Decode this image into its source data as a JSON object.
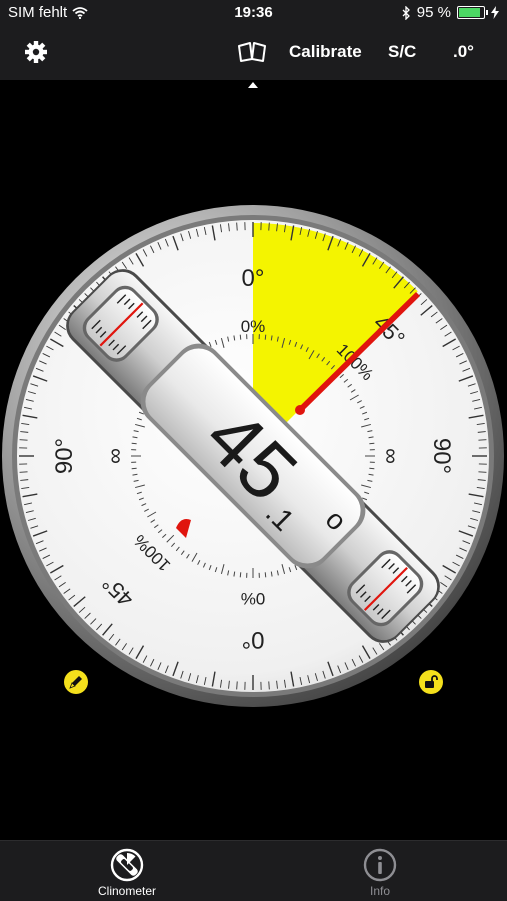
{
  "status_bar": {
    "carrier": "SIM fehlt",
    "wifi_icon": "wifi-icon",
    "time": "19:36",
    "bluetooth_icon": "bluetooth-icon",
    "battery_percent": "95 %",
    "battery_level": 0.95,
    "charging_icon": "bolt-icon"
  },
  "toolbar": {
    "settings_icon": "gear-icon",
    "calibration_icon": "calibration-book-icon",
    "calibrate_label": "Calibrate",
    "sc_label": "S/C",
    "precision_label": ".0°"
  },
  "clinometer": {
    "angle_whole": "45",
    "angle_decimal": ".1",
    "degree_symbol": "o",
    "scale_labels": {
      "top_deg": "0°",
      "top_pct": "0%",
      "pct_100_upper": "100%",
      "deg_45_upper": "45°",
      "right_deg": "90°",
      "right_inf": "∞",
      "left_deg": "90°",
      "left_inf": "∞",
      "deg_45_lower": "45°",
      "pct_100_lower": "100%",
      "bottom_pct": "0%",
      "bottom_deg": "0°"
    },
    "highlight_color": "#f4f400",
    "needle_color": "#e0150e"
  },
  "side_buttons": {
    "left_icon": "hold-pencil-icon",
    "right_icon": "unlock-icon"
  },
  "tabs": [
    {
      "label": "Clinometer",
      "icon": "clinometer-icon",
      "active": true
    },
    {
      "label": "Info",
      "icon": "info-icon",
      "active": false
    }
  ]
}
